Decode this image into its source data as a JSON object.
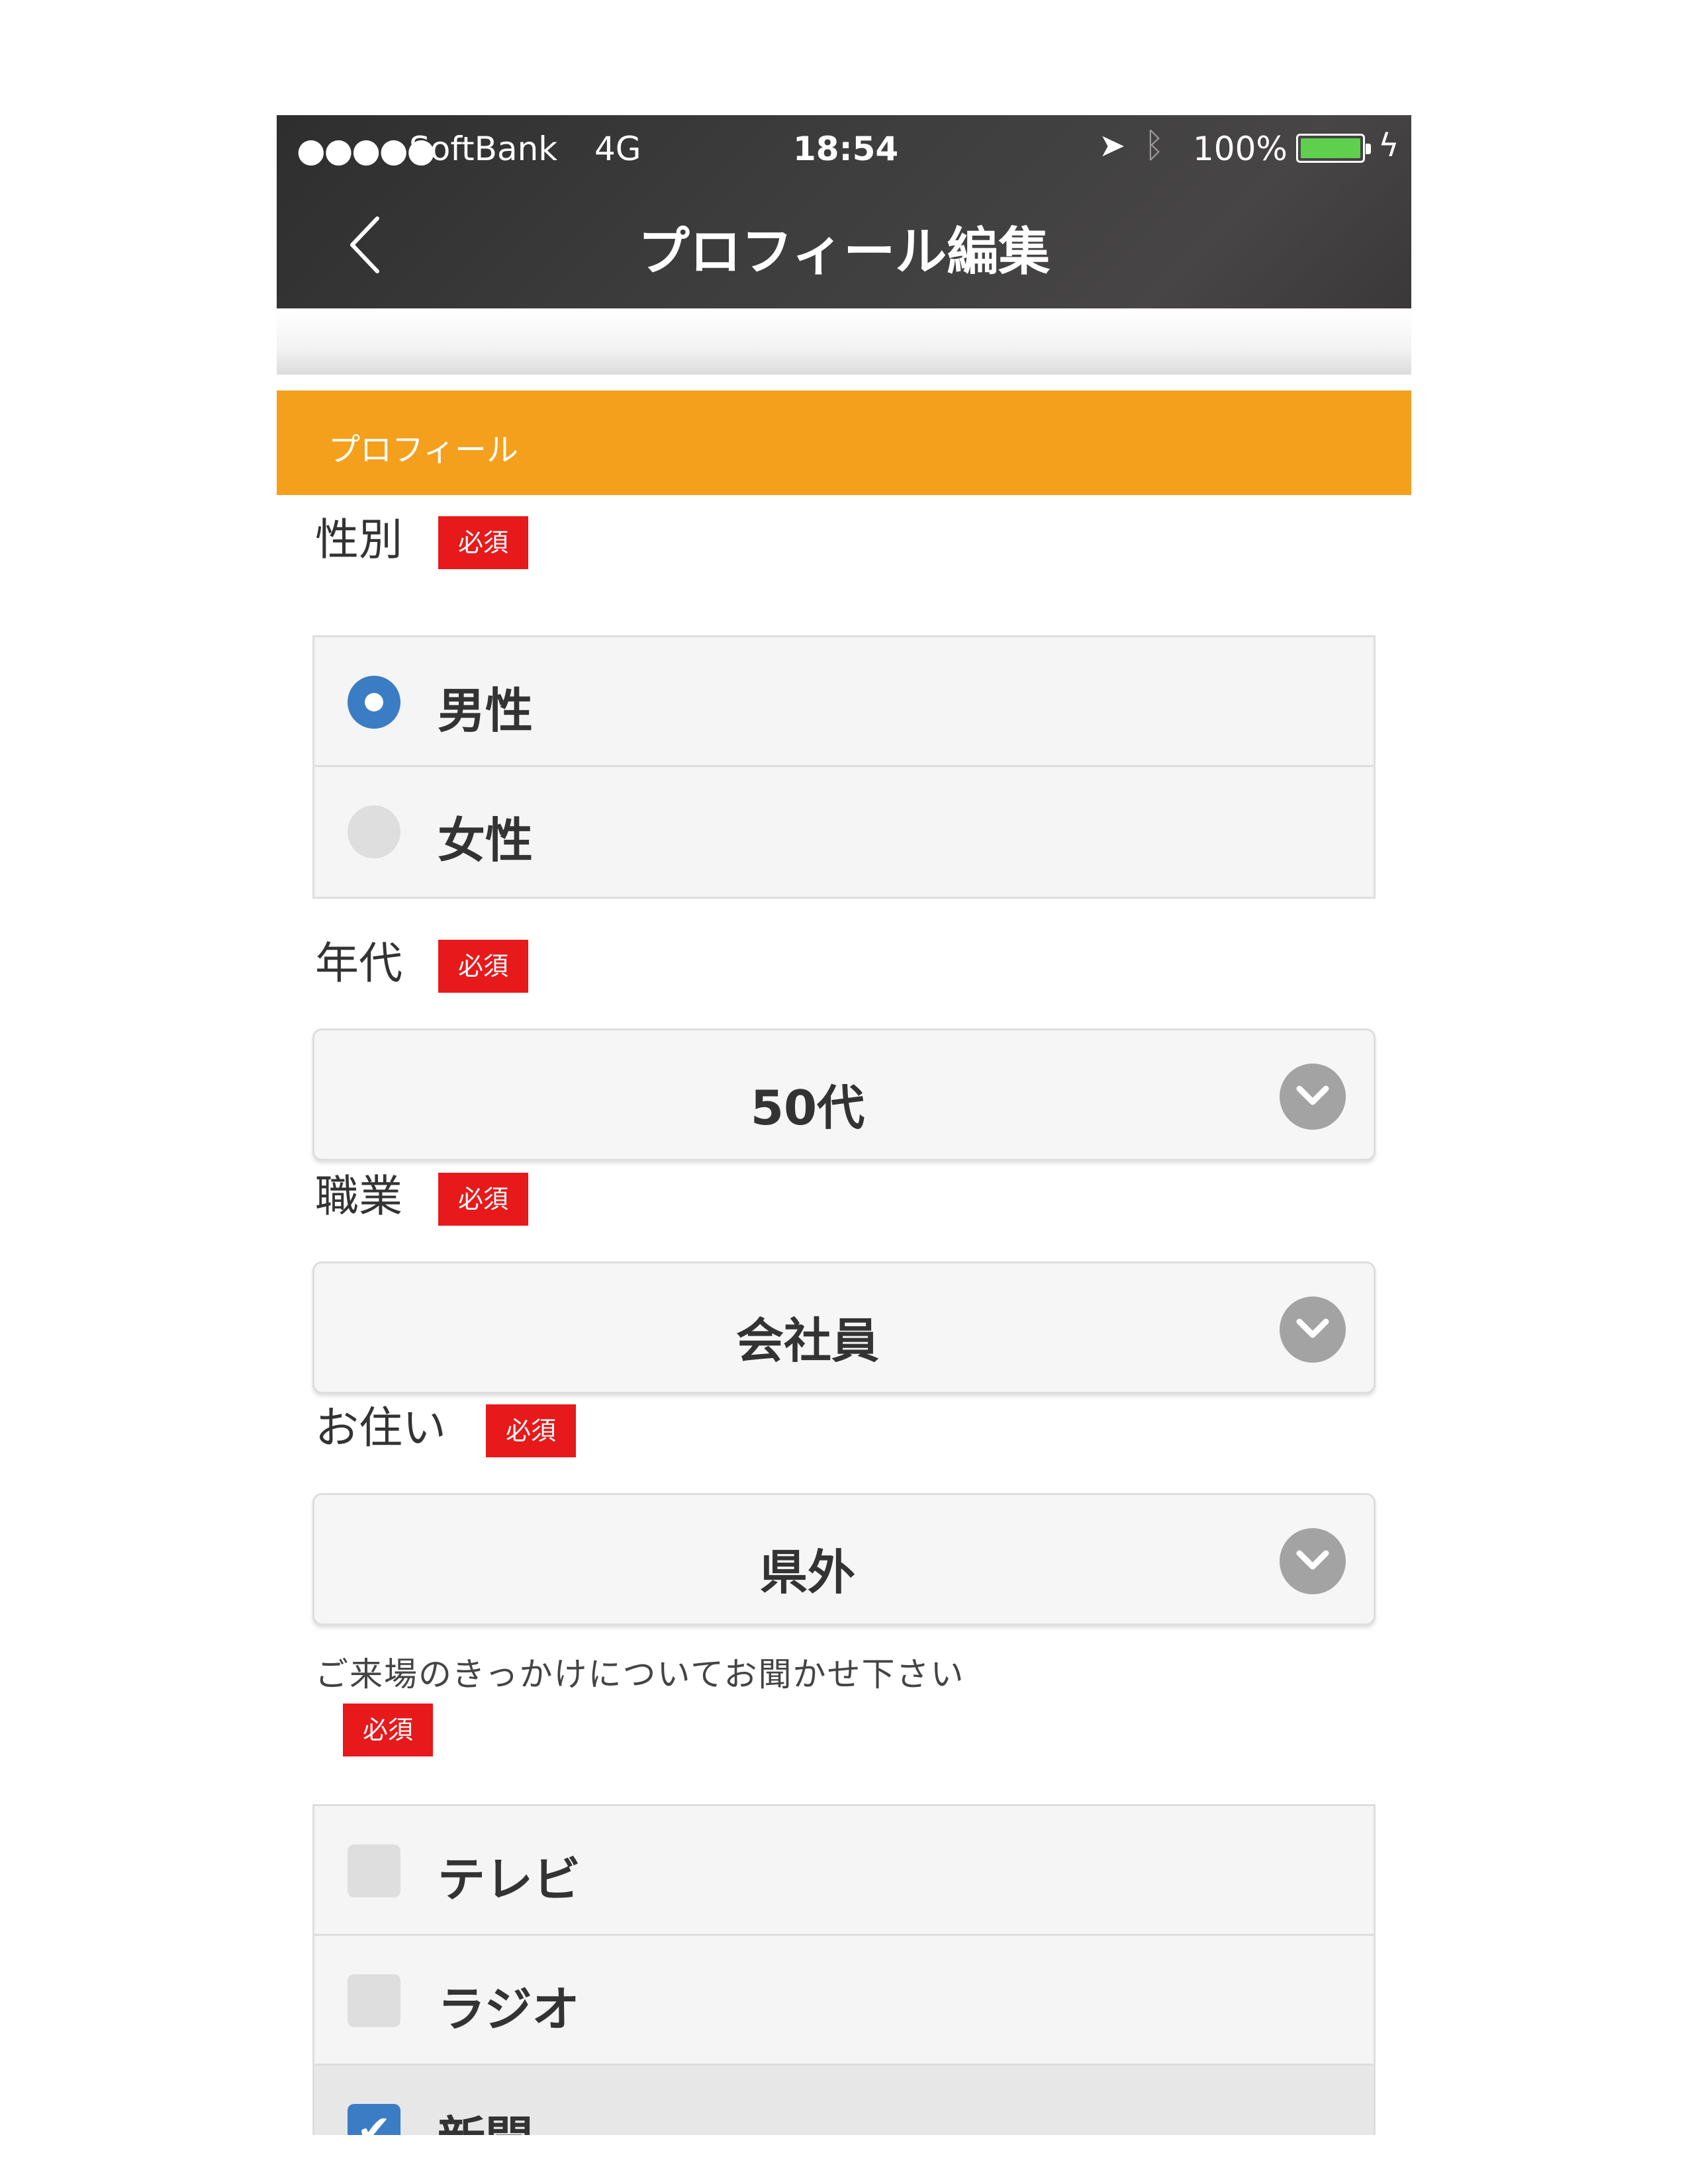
{
  "status_bar": {
    "signal": "●●●●●",
    "carrier": "SoftBank",
    "network": "4G",
    "time": "18:54",
    "battery_pct": "100%",
    "battery_level": 1.0
  },
  "nav": {
    "title": "プロフィール編集",
    "back_icon": "chevron-left-icon"
  },
  "section": {
    "title": "プロフィール"
  },
  "gender": {
    "label": "性別",
    "required": "必須",
    "options": [
      {
        "label": "男性",
        "selected": true
      },
      {
        "label": "女性",
        "selected": false
      }
    ]
  },
  "age": {
    "label": "年代",
    "required": "必須",
    "value": "50代"
  },
  "occupation": {
    "label": "職業",
    "required": "必須",
    "value": "会社員"
  },
  "residence": {
    "label": "お住い",
    "required": "必須",
    "value": "県外"
  },
  "visit_reason": {
    "question": "ご来場のきっかけについてお聞かせ下さい",
    "required": "必須",
    "options": [
      {
        "label": "テレビ",
        "checked": false
      },
      {
        "label": "ラジオ",
        "checked": false
      },
      {
        "label": "新聞",
        "checked": true
      }
    ]
  },
  "colors": {
    "accent": "#f4a01c",
    "required_badge": "#e8191b",
    "selected": "#3b7dc4"
  }
}
